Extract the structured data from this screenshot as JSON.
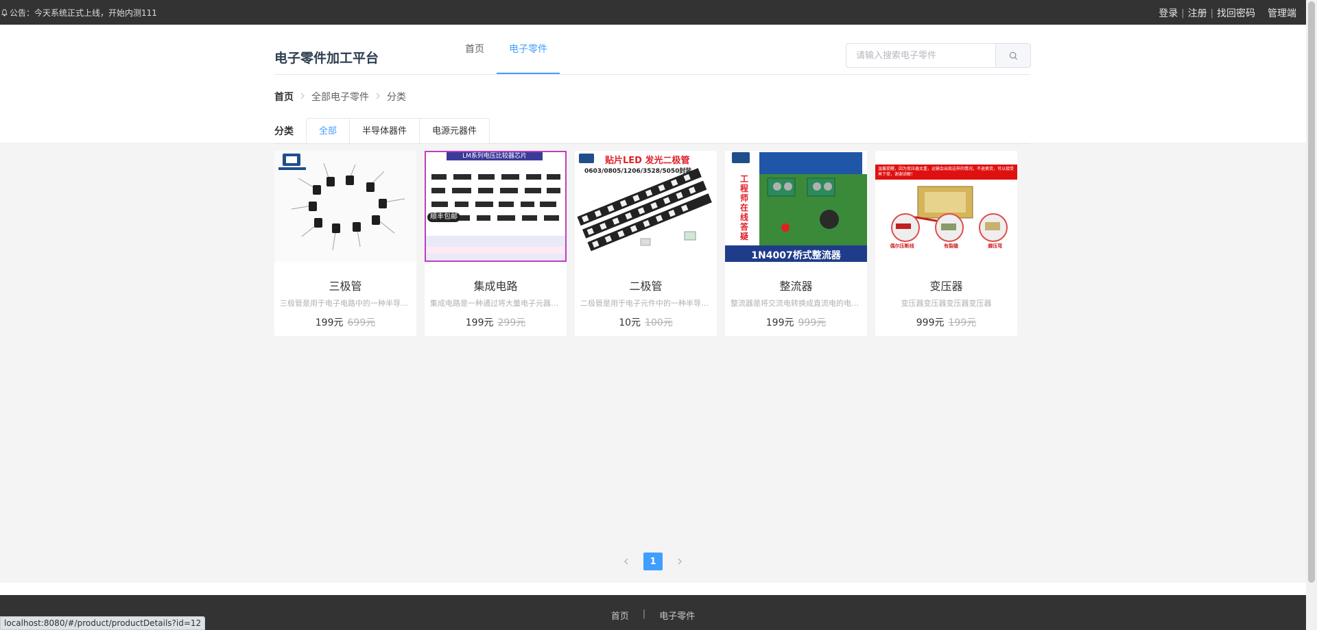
{
  "topbar": {
    "notice": "公告：今天系统正式上线，开始内测111",
    "login": "登录",
    "register": "注册",
    "forgot": "找回密码",
    "admin": "管理端"
  },
  "header": {
    "logo": "电子零件加工平台",
    "nav": [
      "首页",
      "电子零件"
    ],
    "search_placeholder": "请输入搜索电子零件"
  },
  "breadcrumb": [
    "首页",
    "全部电子零件",
    "分类"
  ],
  "category": {
    "label": "分类",
    "tabs": [
      "全部",
      "半导体器件",
      "电源元器件"
    ]
  },
  "products": [
    {
      "name": "三极管",
      "desc": "三极管是用于电子电路中的一种半导体器件",
      "price": "199元",
      "old_price": "699元"
    },
    {
      "name": "集成电路",
      "desc": "集成电路是一种通过将大量电子元器件集成",
      "price": "199元",
      "old_price": "299元"
    },
    {
      "name": "二极管",
      "desc": "二极管是用于电子元件中的一种半导体器件",
      "price": "10元",
      "old_price": "100元"
    },
    {
      "name": "整流器",
      "desc": "整流器是将交流电转换成直流电的电子设备",
      "price": "199元",
      "old_price": "999元"
    },
    {
      "name": "变压器",
      "desc": "变压器变压器变压器变压器",
      "price": "999元",
      "old_price": "199元"
    }
  ],
  "image_text": {
    "img2_banner": "LM系列电压比较器芯片",
    "img2_badge": "顺丰包邮",
    "img3_title": "贴片LED 发光二极管",
    "img3_sizes": "0603/0805/1206/3528/5050封装",
    "img4_side": "工程师在线答疑",
    "img4_bottom": "1N4007桥式整流器",
    "img5_top": "温馨提醒，因为变压器太重，运输会出现这样的情况，不退换货，可以接受再下单，谢谢谅解！",
    "img5_labels": [
      "偶尔压断线",
      "有裂缝",
      "脚压弯"
    ]
  },
  "pagination": {
    "current": "1"
  },
  "footer": {
    "links": [
      "首页",
      "电子零件"
    ]
  },
  "statusbar": "localhost:8080/#/product/productDetails?id=12"
}
